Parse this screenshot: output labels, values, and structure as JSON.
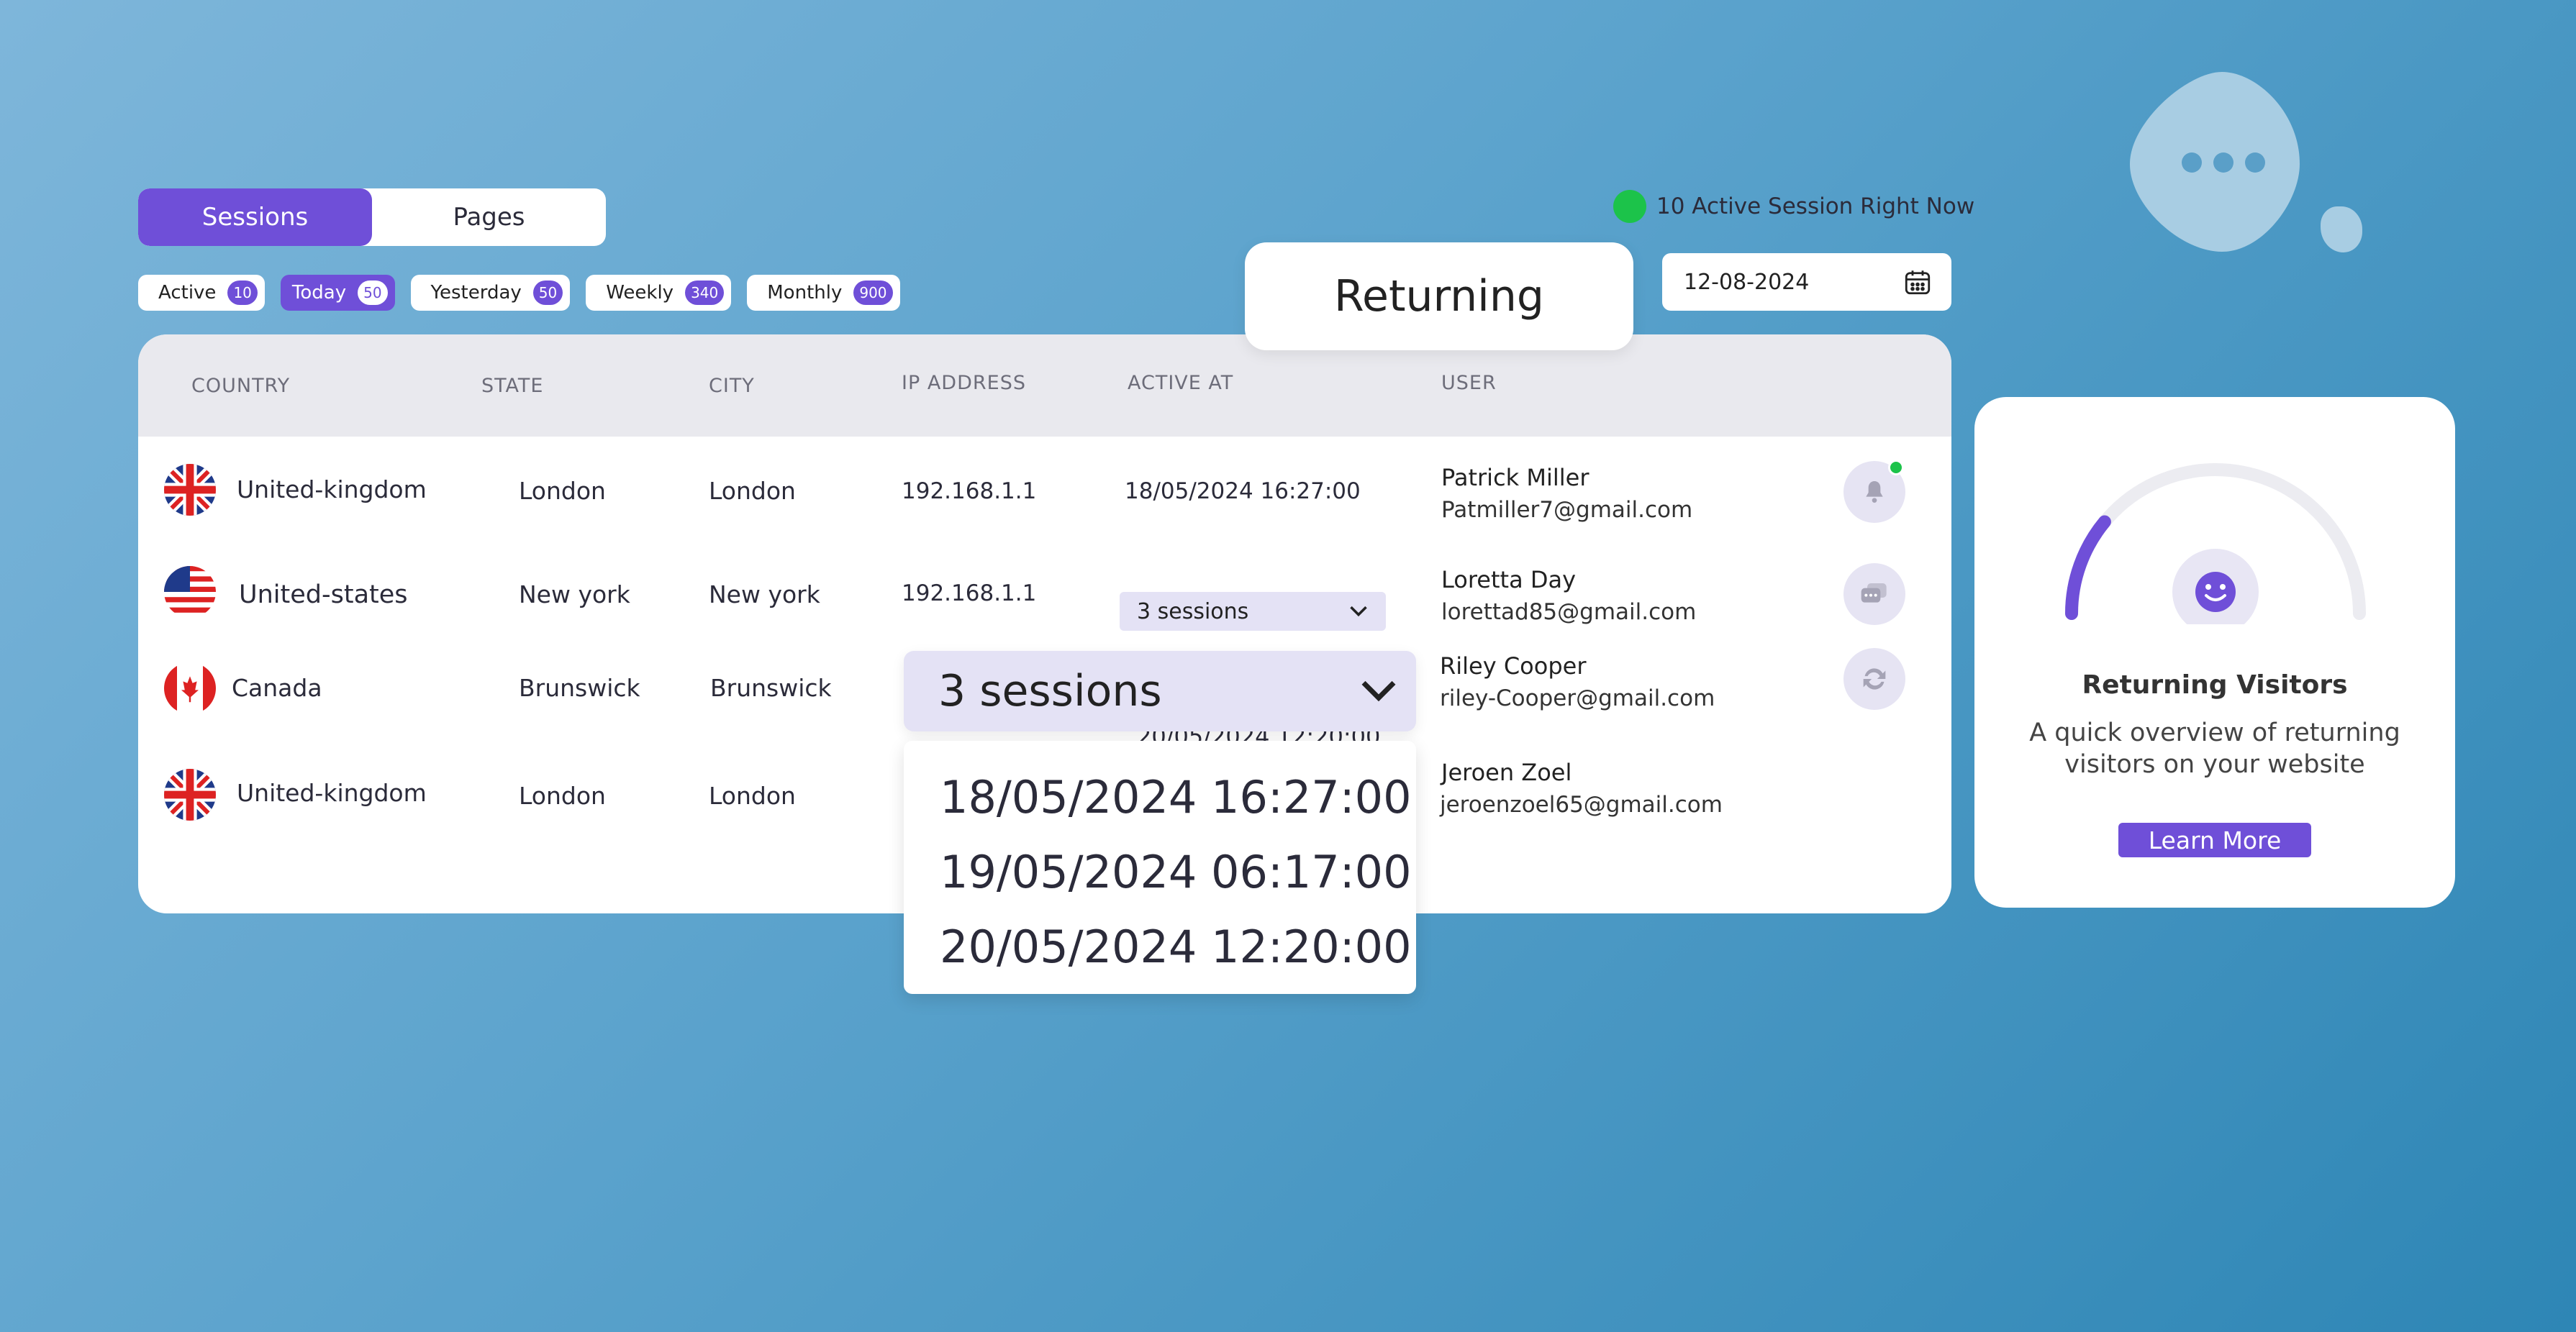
{
  "tabs": [
    {
      "label": "Sessions",
      "active": true
    },
    {
      "label": "Pages",
      "active": false
    }
  ],
  "filters": [
    {
      "label": "Active",
      "count": "10",
      "active": false
    },
    {
      "label": "Today",
      "count": "50",
      "active": true
    },
    {
      "label": "Yesterday",
      "count": "50",
      "active": false
    },
    {
      "label": "Weekly",
      "count": "340",
      "active": false
    },
    {
      "label": "Monthly",
      "count": "900",
      "active": false
    }
  ],
  "live": {
    "text": "10 Active Session Right Now",
    "color": "#1cc34a"
  },
  "date_picker": {
    "value": "12-08-2024",
    "icon": "calendar-icon"
  },
  "returning_label": "Returning",
  "table": {
    "headers": [
      "COUNTRY",
      "STATE",
      "CITY",
      "IP ADDRESS",
      "ACTIVE AT",
      "USER"
    ],
    "rows": [
      {
        "country": "United-kingdom",
        "flag": "uk-flag-icon",
        "state": "London",
        "city": "London",
        "ip": "192.168.1.1",
        "active_at": "18/05/2024 16:27:00",
        "user_name": "Patrick Miller",
        "user_email": "Patmiller7@gmail.com",
        "action_icon": "bell-icon"
      },
      {
        "country": "United-states",
        "flag": "us-flag-icon",
        "state": "New york",
        "city": "New york",
        "ip": "192.168.1.1",
        "active_at": "3 sessions",
        "user_name": "Loretta Day",
        "user_email": "lorettad85@gmail.com",
        "action_icon": "chat-icon"
      },
      {
        "country": "Canada",
        "flag": "canada-flag-icon",
        "state": "Brunswick",
        "city": "Brunswick",
        "ip": "",
        "active_at": "20/05/2024 12:20:00",
        "user_name": "Riley Cooper",
        "user_email": "riley-Cooper@gmail.com",
        "action_icon": "refresh-icon"
      },
      {
        "country": "United-kingdom",
        "flag": "uk-flag-icon",
        "state": "London",
        "city": "London",
        "ip": "",
        "active_at": "",
        "user_name": "Jeroen Zoel",
        "user_email": "jeroenzoel65@gmail.com",
        "action_icon": ""
      }
    ]
  },
  "sessions_dropdown": {
    "label": "3 sessions",
    "options": [
      "18/05/2024 16:27:00",
      "19/05/2024 06:17:00",
      "20/05/2024 12:20:00"
    ]
  },
  "side_card": {
    "title": "Returning Visitors",
    "description": "A quick overview of returning visitors on your website",
    "button": "Learn More",
    "gauge_fraction": 0.22,
    "accent": "#6f4fd8"
  },
  "colors": {
    "accent": "#6f4fd8",
    "online": "#1cc34a"
  }
}
